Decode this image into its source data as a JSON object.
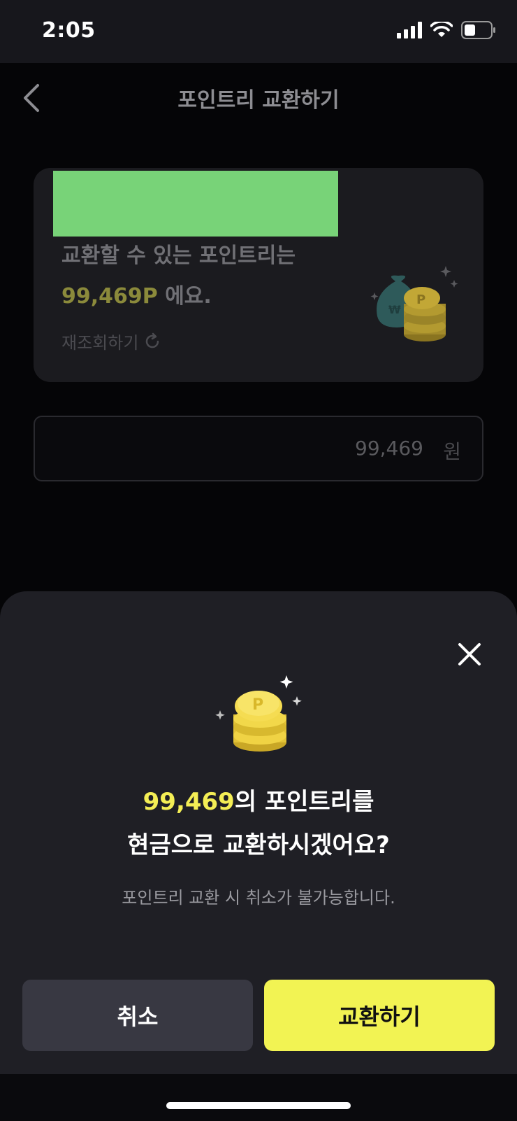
{
  "status_bar": {
    "time": "2:05"
  },
  "header": {
    "title": "포인트리 교환하기",
    "back_icon": "chevron-left-icon"
  },
  "points_card": {
    "line1": "교환할 수 있는 포인트리는",
    "amount": "99,469P",
    "suffix": " 에요.",
    "refresh_label": "재조회하기"
  },
  "amount_field": {
    "value": "99,469",
    "unit": "원"
  },
  "sheet": {
    "title_amount": "99,469",
    "title_rest": "의 포인트리를",
    "title_line2": "현금으로 교환하시겠어요?",
    "subtitle": "포인트리 교환 시 취소가 불가능합니다.",
    "cancel_label": "취소",
    "confirm_label": "교환하기"
  },
  "colors": {
    "accent_yellow": "#f2f353",
    "highlight_text": "#f4ee55"
  }
}
